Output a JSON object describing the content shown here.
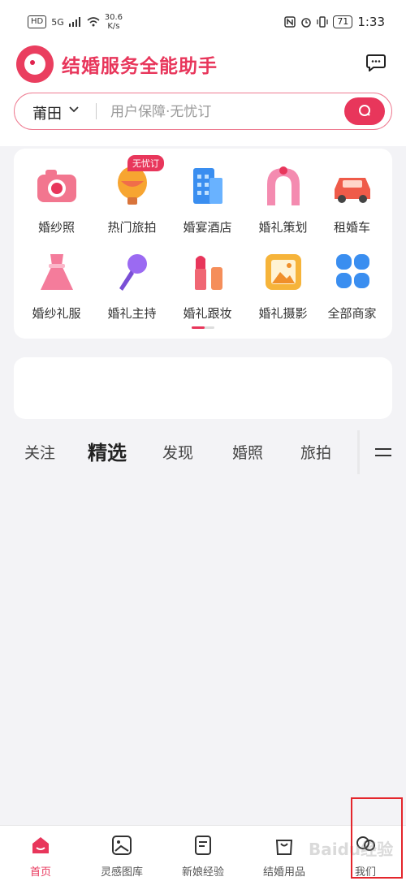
{
  "status_bar": {
    "hd": "HD",
    "signal": "5G",
    "net_speed": "30.6",
    "net_unit": "K/s",
    "battery": "71",
    "time": "1:33"
  },
  "header": {
    "title": "结婚服务全能助手"
  },
  "search": {
    "city": "莆田",
    "placeholder": "用户保障·无忧订"
  },
  "categories": [
    {
      "label": "婚纱照",
      "icon": "camera-icon"
    },
    {
      "label": "热门旅拍",
      "icon": "balloon-icon",
      "badge": "无忧订"
    },
    {
      "label": "婚宴酒店",
      "icon": "hotel-icon"
    },
    {
      "label": "婚礼策划",
      "icon": "arch-icon"
    },
    {
      "label": "租婚车",
      "icon": "car-icon"
    },
    {
      "label": "婚纱礼服",
      "icon": "dress-icon"
    },
    {
      "label": "婚礼主持",
      "icon": "microphone-icon"
    },
    {
      "label": "婚礼跟妆",
      "icon": "lipstick-icon"
    },
    {
      "label": "婚礼摄影",
      "icon": "photo-icon"
    },
    {
      "label": "全部商家",
      "icon": "grid-icon"
    }
  ],
  "feed_tabs": [
    "关注",
    "精选",
    "发现",
    "婚照",
    "旅拍"
  ],
  "active_tab": "精选",
  "bottom_nav": [
    {
      "label": "首页",
      "icon": "home-icon",
      "active": true
    },
    {
      "label": "灵感图库",
      "icon": "gallery-icon"
    },
    {
      "label": "新娘经验",
      "icon": "notes-icon"
    },
    {
      "label": "结婚用品",
      "icon": "bag-icon"
    },
    {
      "label": "我们",
      "icon": "couple-icon"
    }
  ],
  "watermark": "Baidu经验",
  "colors": {
    "accent": "#e8365b",
    "highlight": "#e4262c"
  }
}
